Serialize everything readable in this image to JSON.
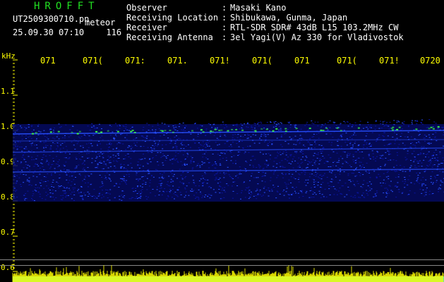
{
  "header": {
    "brand": "HROFFT",
    "filename": "UT2509300710.pn",
    "mode": "meteor",
    "date": "25.09.30",
    "time": "07:10",
    "count": "116"
  },
  "meta": [
    {
      "label": "Observer",
      "value": "Masaki Kano"
    },
    {
      "label": "Receiving Location",
      "value": "Shibukawa, Gunma, Japan"
    },
    {
      "label": "Receiver",
      "value": "RTL-SDR SDR# 43dB L15 103.2MHz CW"
    },
    {
      "label": "Receiving Antenna",
      "value": "3el Yagi(V) Az 330 for Vladivostok"
    }
  ],
  "axis": {
    "y_unit": "kHz",
    "y_ticks": [
      "1.1",
      "1.0",
      "0.9",
      "0.8",
      "0.7",
      "0.6"
    ],
    "x_ticks": [
      "071",
      "071(",
      "071:",
      "071.",
      "071!",
      "071(",
      "071",
      "071(",
      "071!",
      "0720"
    ]
  },
  "colors": {
    "background": "#000000",
    "axis_text": "#ffff00",
    "brand": "#22e022",
    "signal_low": "#0a14a0",
    "signal_high": "#2850ff",
    "meteor": "#40ff40",
    "baseline_yellow": "#ffff00",
    "baseline_cyan": "#00d0ff"
  }
}
